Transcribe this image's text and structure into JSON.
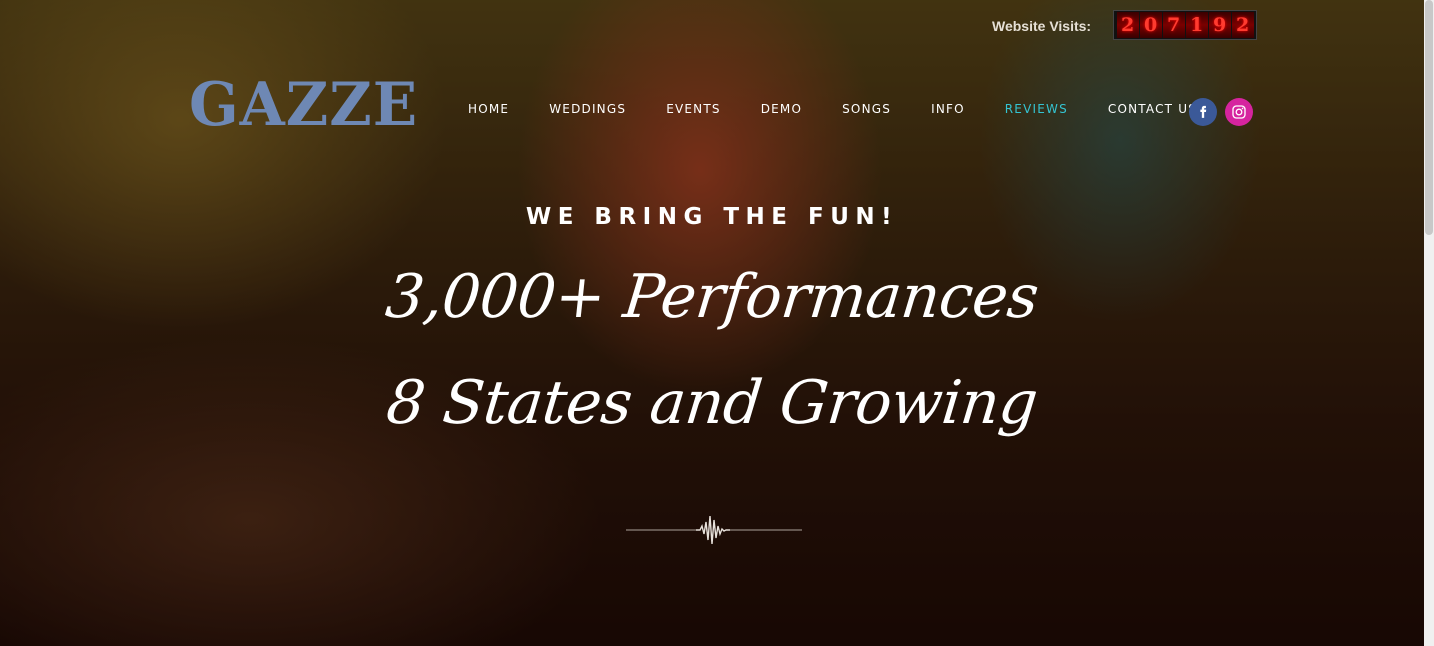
{
  "visits": {
    "label": "Website Visits:",
    "digits": [
      "2",
      "0",
      "7",
      "1",
      "9",
      "2"
    ]
  },
  "logo": {
    "text": "GAZZE",
    "color": "#6e88b4"
  },
  "nav": {
    "items": [
      {
        "label": "HOME"
      },
      {
        "label": "WEDDINGS"
      },
      {
        "label": "EVENTS"
      },
      {
        "label": "DEMO"
      },
      {
        "label": "SONGS"
      },
      {
        "label": "INFO"
      },
      {
        "label": "REVIEWS"
      },
      {
        "label": "CONTACT US"
      }
    ],
    "active_color": "#34c4d2"
  },
  "social": {
    "facebook_icon": "facebook-icon",
    "instagram_icon": "instagram-icon",
    "facebook_color": "#3b5998",
    "instagram_color": "#d6249f"
  },
  "hero": {
    "tagline": "WE BRING THE FUN!",
    "line1": "3,000+ Performances",
    "line2": "8 States and Growing",
    "divider_icon": "sound-wave-icon"
  }
}
